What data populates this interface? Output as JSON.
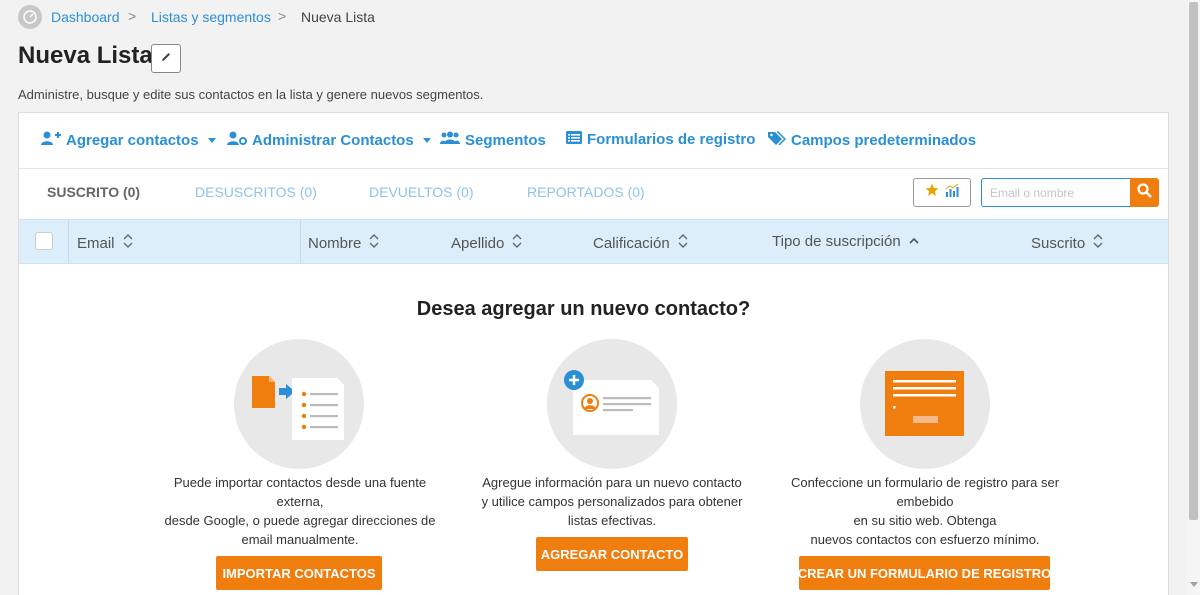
{
  "breadcrumb": {
    "items": [
      "Dashboard",
      "Listas y segmentos"
    ],
    "separator": ">",
    "current": "Nueva Lista"
  },
  "page": {
    "title": "Nueva Lista",
    "subtitle": "Administre, busque y edite sus contactos en la lista y genere nuevos segmentos."
  },
  "toolbar": {
    "items": [
      {
        "label": "Agregar contactos",
        "icon": "user-plus-icon",
        "dropdown": true
      },
      {
        "label": "Administrar Contactos",
        "icon": "user-gear-icon",
        "dropdown": true
      },
      {
        "label": "Segmentos",
        "icon": "users-icon",
        "dropdown": false
      },
      {
        "label": "Formularios de registro",
        "icon": "list-form-icon",
        "dropdown": false
      },
      {
        "label": "Campos predeterminados",
        "icon": "tags-icon",
        "dropdown": false
      }
    ]
  },
  "tabs": [
    {
      "label": "SUSCRITO (0)",
      "active": true
    },
    {
      "label": "DESUSCRITOS (0)",
      "active": false
    },
    {
      "label": "DEVUELTOS (0)",
      "active": false
    },
    {
      "label": "REPORTADOS (0)",
      "active": false
    }
  ],
  "search": {
    "placeholder": "Email o nombre",
    "value": ""
  },
  "table": {
    "columns": [
      "Email",
      "Nombre",
      "Apellido",
      "Calificación",
      "Tipo de suscripción",
      "Suscrito"
    ],
    "sorted_column": "Tipo de suscripción"
  },
  "empty": {
    "title": "Desea agregar un nuevo contacto?",
    "cards": [
      {
        "description": [
          "Puede importar contactos desde una fuente",
          "externa,",
          "desde Google, o puede agregar direcciones de",
          "email manualmente."
        ],
        "button": "IMPORTAR CONTACTOS"
      },
      {
        "description": [
          "Agregue información para un nuevo contacto",
          "y utilice campos personalizados para obtener",
          "listas efectivas."
        ],
        "button": "AGREGAR CONTACTO"
      },
      {
        "description": [
          "Confeccione un formulario de registro para ser",
          "embebido",
          "en su sitio web. Obtenga",
          "nuevos contactos con esfuerzo mínimo."
        ],
        "button": "CREAR UN FORMULARIO DE REGISTRO"
      }
    ]
  },
  "colors": {
    "accent": "#2b8fd6",
    "cta": "#f07e0e",
    "header_bg": "#dbeef9"
  }
}
